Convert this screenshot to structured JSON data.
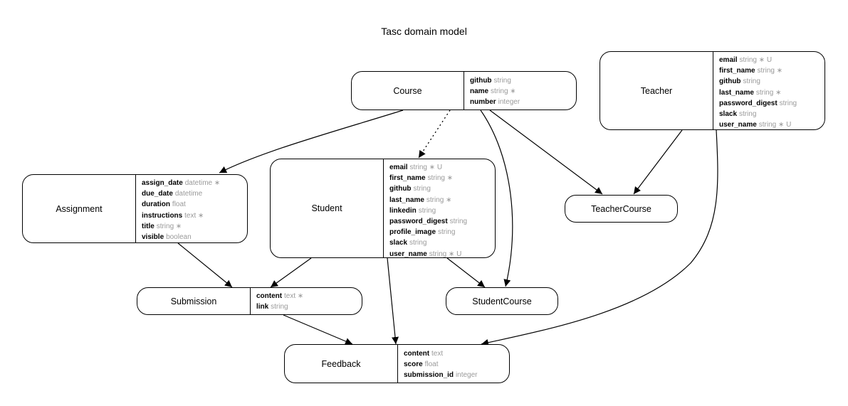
{
  "title": "Tasc domain model",
  "entities": {
    "course": {
      "name": "Course",
      "attributes": [
        {
          "name": "github",
          "type": "string"
        },
        {
          "name": "name",
          "type": "string ∗"
        },
        {
          "name": "number",
          "type": "integer"
        }
      ]
    },
    "teacher": {
      "name": "Teacher",
      "attributes": [
        {
          "name": "email",
          "type": "string ∗ U"
        },
        {
          "name": "first_name",
          "type": "string ∗"
        },
        {
          "name": "github",
          "type": "string"
        },
        {
          "name": "last_name",
          "type": "string ∗"
        },
        {
          "name": "password_digest",
          "type": "string"
        },
        {
          "name": "slack",
          "type": "string"
        },
        {
          "name": "user_name",
          "type": "string ∗ U"
        }
      ]
    },
    "assignment": {
      "name": "Assignment",
      "attributes": [
        {
          "name": "assign_date",
          "type": "datetime ∗"
        },
        {
          "name": "due_date",
          "type": "datetime"
        },
        {
          "name": "duration",
          "type": "float"
        },
        {
          "name": "instructions",
          "type": "text ∗"
        },
        {
          "name": "title",
          "type": "string ∗"
        },
        {
          "name": "visible",
          "type": "boolean"
        }
      ]
    },
    "student": {
      "name": "Student",
      "attributes": [
        {
          "name": "email",
          "type": "string ∗ U"
        },
        {
          "name": "first_name",
          "type": "string ∗"
        },
        {
          "name": "github",
          "type": "string"
        },
        {
          "name": "last_name",
          "type": "string ∗"
        },
        {
          "name": "linkedin",
          "type": "string"
        },
        {
          "name": "password_digest",
          "type": "string"
        },
        {
          "name": "profile_image",
          "type": "string"
        },
        {
          "name": "slack",
          "type": "string"
        },
        {
          "name": "user_name",
          "type": "string ∗ U"
        }
      ]
    },
    "teacher_course": {
      "name": "TeacherCourse",
      "attributes": []
    },
    "submission": {
      "name": "Submission",
      "attributes": [
        {
          "name": "content",
          "type": "text ∗"
        },
        {
          "name": "link",
          "type": "string"
        }
      ]
    },
    "student_course": {
      "name": "StudentCourse",
      "attributes": []
    },
    "feedback": {
      "name": "Feedback",
      "attributes": [
        {
          "name": "content",
          "type": "text"
        },
        {
          "name": "score",
          "type": "float"
        },
        {
          "name": "submission_id",
          "type": "integer"
        }
      ]
    }
  },
  "relationships": [
    {
      "from": "Course",
      "to": "Assignment",
      "style": "solid"
    },
    {
      "from": "Course",
      "to": "Student",
      "style": "dotted"
    },
    {
      "from": "Course",
      "to": "StudentCourse",
      "style": "solid"
    },
    {
      "from": "Course",
      "to": "TeacherCourse",
      "style": "solid"
    },
    {
      "from": "Teacher",
      "to": "TeacherCourse",
      "style": "solid"
    },
    {
      "from": "Teacher",
      "to": "Feedback",
      "style": "solid"
    },
    {
      "from": "Assignment",
      "to": "Submission",
      "style": "solid"
    },
    {
      "from": "Student",
      "to": "Submission",
      "style": "solid"
    },
    {
      "from": "Student",
      "to": "Feedback",
      "style": "solid"
    },
    {
      "from": "Student",
      "to": "StudentCourse",
      "style": "solid"
    },
    {
      "from": "Submission",
      "to": "Feedback",
      "style": "solid"
    }
  ]
}
